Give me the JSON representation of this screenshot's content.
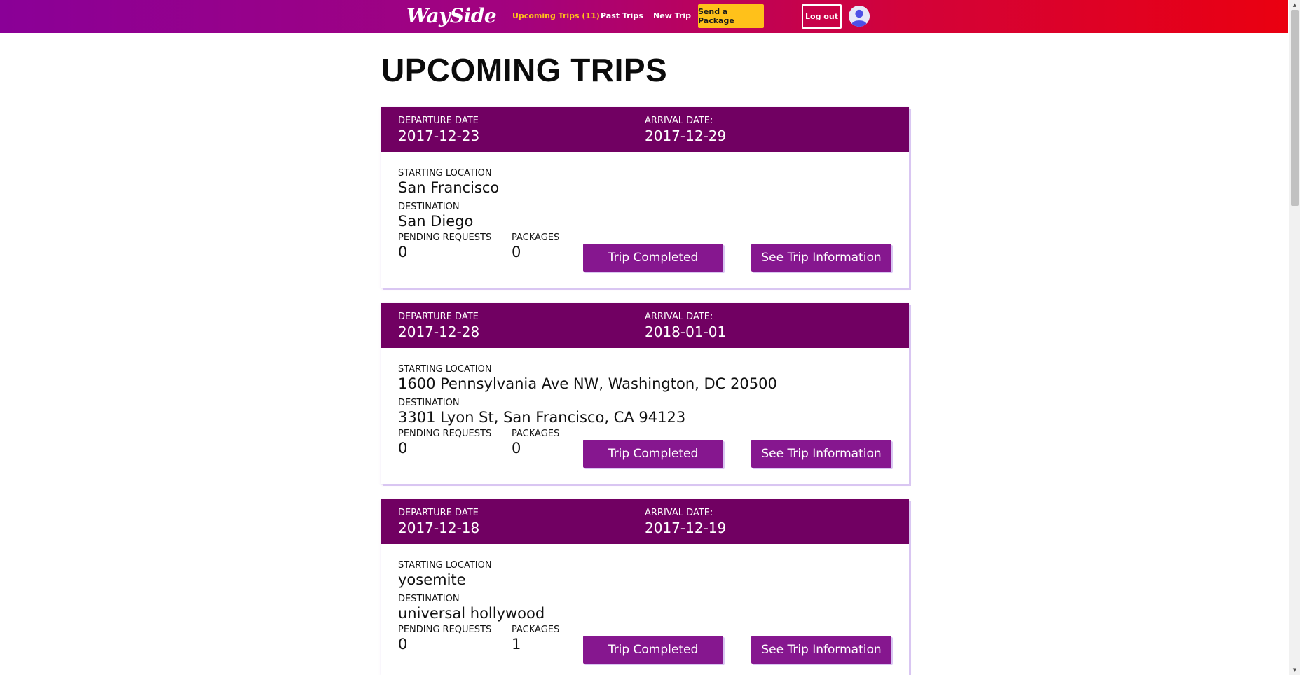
{
  "navbar": {
    "logo": "WaySide",
    "upcoming_trips": "Upcoming Trips (11)",
    "past_trips": "Past Trips",
    "new_trip": "New Trip",
    "send_package": "Send a Package",
    "logout": "Log out"
  },
  "colors": {
    "nav_gradient_start": "#8a0097",
    "nav_gradient_end": "#ea0010",
    "active_link": "#ffc11a",
    "card_header": "#710062",
    "button": "#86178f"
  },
  "page": {
    "title": "UPCOMING TRIPS"
  },
  "labels": {
    "departure_date": "DEPARTURE DATE",
    "arrival_date": "ARRIVAL DATE:",
    "starting_location": "STARTING LOCATION",
    "destination": "DESTINATION",
    "pending_requests": "PENDING REQUESTS",
    "packages": "PACKAGES",
    "trip_completed": "Trip Completed",
    "see_trip_information": "See Trip Information"
  },
  "trips": [
    {
      "departure_date": "2017-12-23",
      "arrival_date": "2017-12-29",
      "starting_location": "San Francisco",
      "destination": "San Diego",
      "pending_requests": "0",
      "packages": "0"
    },
    {
      "departure_date": "2017-12-28",
      "arrival_date": "2018-01-01",
      "starting_location": "1600 Pennsylvania Ave NW, Washington, DC 20500",
      "destination": "3301 Lyon St, San Francisco, CA 94123",
      "pending_requests": "0",
      "packages": "0"
    },
    {
      "departure_date": "2017-12-18",
      "arrival_date": "2017-12-19",
      "starting_location": "yosemite",
      "destination": "universal hollywood",
      "pending_requests": "0",
      "packages": "1"
    }
  ]
}
